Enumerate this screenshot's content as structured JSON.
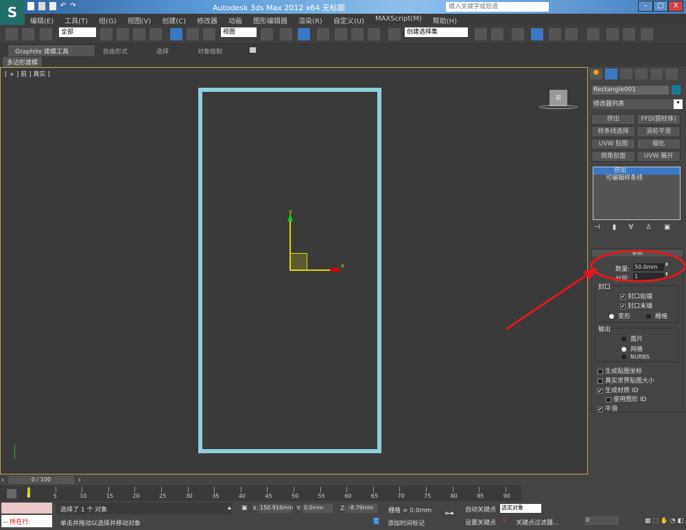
{
  "title": {
    "text": "Autodesk 3ds Max  2012 x64      无标题",
    "search_placeholder": "键入关键字或短语",
    "min": "–",
    "max": "□",
    "close": "X"
  },
  "menu": [
    "编辑(E)",
    "工具(T)",
    "组(G)",
    "视图(V)",
    "创建(C)",
    "修改器",
    "动画",
    "图形编辑器",
    "渲染(R)",
    "自定义(U)",
    "MAXScript(M)",
    "帮助(H)"
  ],
  "toolbar": {
    "selection_filter": "全部",
    "ref_coord": "视图",
    "named_selection": "创建选择集"
  },
  "ribbon": {
    "tabs": [
      "Graphite 建模工具",
      "自由形式",
      "选择",
      "对象绘制"
    ],
    "sub": "多边形建模"
  },
  "viewport": {
    "label": "[ + ] 前 ] 真实 ]",
    "viewcube": "前",
    "axis_x": "x",
    "axis_y": "y"
  },
  "panel": {
    "object_name": "Rectangle001",
    "object_color": "#1a7a9a",
    "modifier_list": "修改器列表",
    "buttons": [
      "挤出",
      "FFD(圆柱体)",
      "样条线选择",
      "涡轮平滑",
      "UVW 贴图",
      "细化",
      "倒角剖面",
      "UVW 展开"
    ],
    "stack": [
      "挤出",
      "可编辑样条线"
    ],
    "rollout": "参数",
    "amount_label": "数量:",
    "amount": "50.0mm",
    "segments_label": "分段:",
    "segments": "1",
    "capping": {
      "title": "封口",
      "start": "封口始端",
      "end": "封口末端",
      "morph": "变形",
      "grid": "栅格"
    },
    "output": {
      "title": "输出",
      "patch": "面片",
      "mesh": "网格",
      "nurbs": "NURBS"
    },
    "gen_map": "生成贴图坐标",
    "real_world": "真实世界贴图大小",
    "gen_mat": "生成材质 ID",
    "use_shape": "使用图形 ID",
    "smooth": "平滑",
    "checked": {
      "start": true,
      "end": true,
      "gen_map": false,
      "real_world": false,
      "gen_mat": true,
      "use_shape": false,
      "smooth": true
    },
    "capping_selected": "morph",
    "output_selected": "mesh"
  },
  "timeline": {
    "frame": "0 / 100",
    "ticks": [
      "0",
      "5",
      "10",
      "15",
      "20",
      "25",
      "30",
      "35",
      "40",
      "45",
      "50",
      "55",
      "60",
      "65",
      "70",
      "75",
      "80",
      "85",
      "90"
    ]
  },
  "status": {
    "running": "所在行:",
    "selected": "选择了 1 个 对象",
    "prompt": "单击并拖动以选择并移动对象",
    "x_label": "X:",
    "x": "150.916mm",
    "y_label": "Y:",
    "y": "0.0mm",
    "z_label": "Z:",
    "z": "-8.79mm",
    "grid": "栅格 = 0.0mm",
    "add_time_tag": "添加时间标记",
    "auto_key": "自动关键点",
    "set_key": "设置关键点",
    "key_mode": "选定对象",
    "key_filters": "关键点过滤器...",
    "frame_field": "0"
  },
  "colors": {
    "accent": "#3b78c4",
    "rect": "#8fd0dc",
    "annotation": "#e8141c"
  }
}
